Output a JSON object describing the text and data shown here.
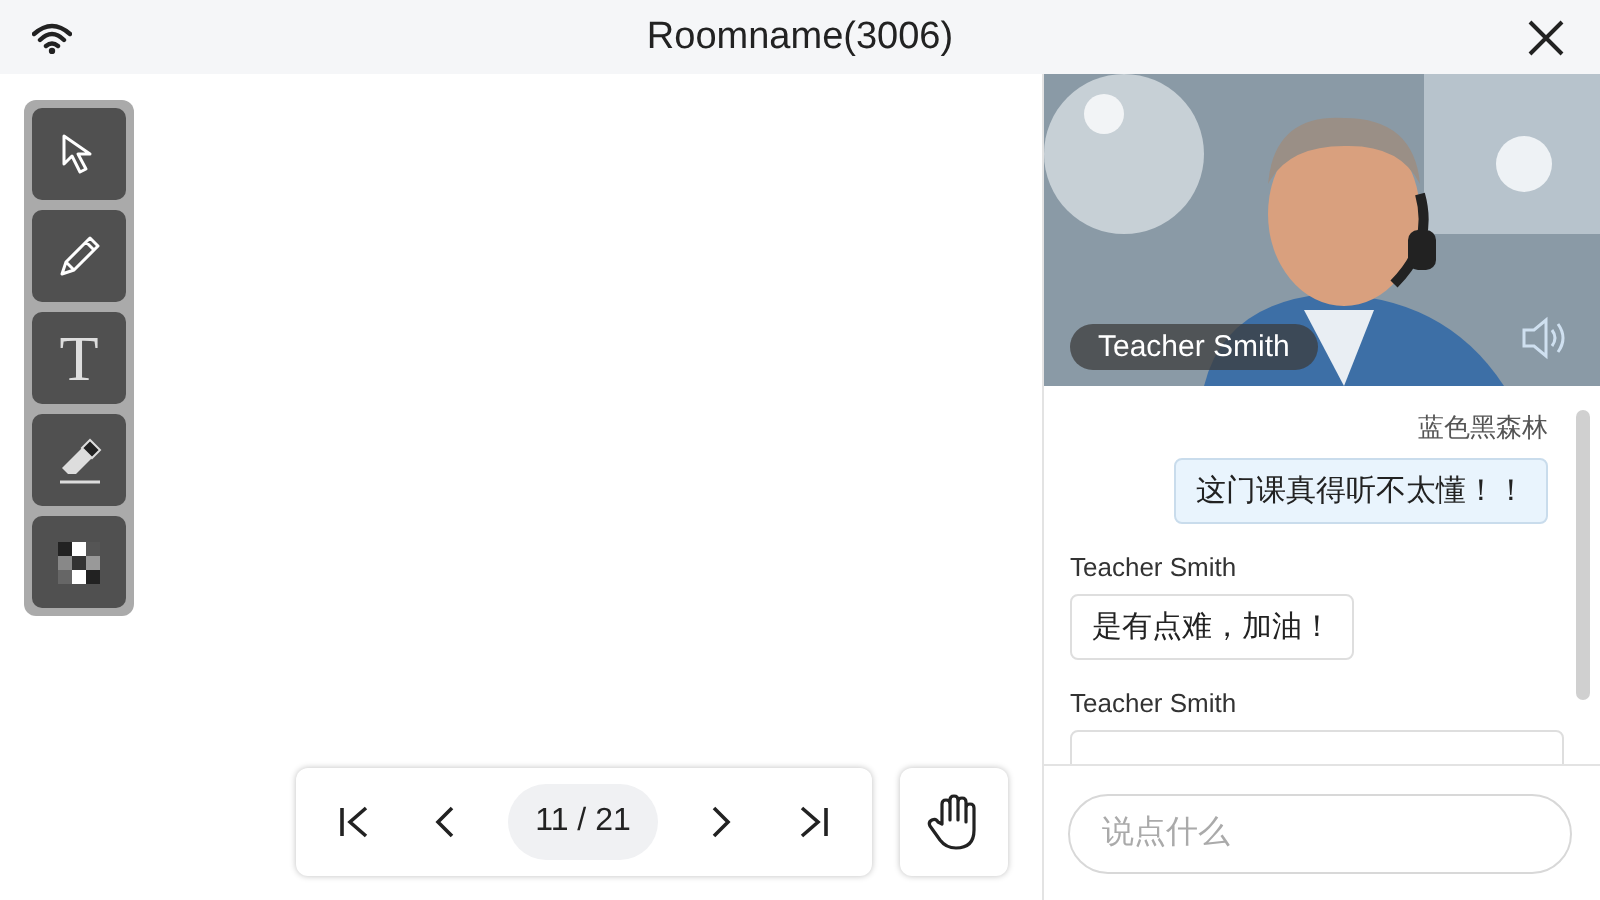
{
  "window": {
    "title": "Roomname(3006)"
  },
  "tools": [
    {
      "kind": "select"
    },
    {
      "kind": "pen"
    },
    {
      "kind": "text",
      "glyph": "T"
    },
    {
      "kind": "eraser"
    },
    {
      "kind": "mosaic"
    }
  ],
  "pager": {
    "page": "11 / 21"
  },
  "video": {
    "name": "Teacher Smith"
  },
  "messages": [
    {
      "sender": "蓝色黑森林",
      "text": "这门课真得听不太懂！！",
      "mine": true
    },
    {
      "sender": "Teacher Smith",
      "text": "是有点难，加油！",
      "mine": false
    },
    {
      "sender": "Teacher Smith",
      "mine": false
    }
  ],
  "composer": {
    "placeholder": "说点什么"
  }
}
